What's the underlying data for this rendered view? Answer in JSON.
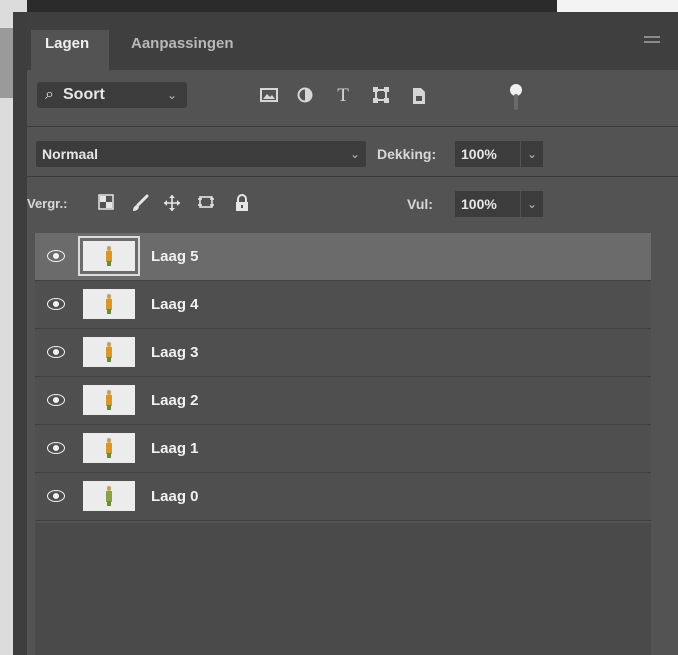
{
  "tabs": {
    "active": "Lagen",
    "inactive": "Aanpassingen"
  },
  "filter": {
    "search_glyph": "⌕",
    "kind_label": "Soort",
    "icons": [
      "image-filter-icon",
      "adjustment-filter-icon",
      "type-filter-icon",
      "shape-filter-icon",
      "smart-object-filter-icon"
    ],
    "toggle": "filter-toggle"
  },
  "blend": {
    "mode": "Normaal",
    "opacity_label": "Dekking:",
    "opacity_value": "100%"
  },
  "lock": {
    "label": "Vergr.:",
    "fill_label": "Vul:",
    "fill_value": "100%"
  },
  "layers": [
    {
      "name": "Laag 5",
      "selected": true
    },
    {
      "name": "Laag 4",
      "selected": false
    },
    {
      "name": "Laag 3",
      "selected": false
    },
    {
      "name": "Laag 2",
      "selected": false
    },
    {
      "name": "Laag 1",
      "selected": false
    },
    {
      "name": "Laag 0",
      "selected": false
    }
  ],
  "colors": {
    "panel_bg": "#535353",
    "selected_row": "#6b6b6b",
    "field_bg": "#3c3c3c"
  }
}
